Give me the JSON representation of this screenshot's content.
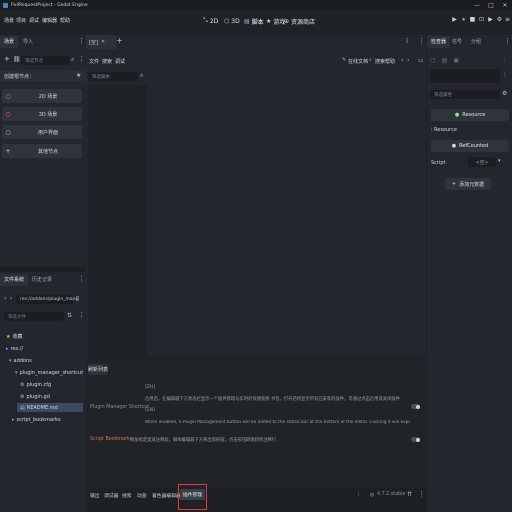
{
  "window": {
    "title": "PullRequestProject - Godot Engine",
    "minimize": "—",
    "maximize": "□",
    "close": "✕"
  },
  "menus": [
    "场景",
    "项目",
    "调试",
    "编辑器",
    "帮助"
  ],
  "workspaces": [
    {
      "icon": "⤡",
      "label": "2D"
    },
    {
      "icon": "⬡",
      "label": "3D"
    },
    {
      "icon": "▤",
      "label": "脚本"
    },
    {
      "icon": "★",
      "label": "游戏"
    },
    {
      "icon": "⊕",
      "label": "资源商店"
    }
  ],
  "run_controls": [
    "▶",
    "⏸",
    "■",
    "⊡",
    "▶",
    "⚙",
    "≡"
  ],
  "scene_dock": {
    "tabs": [
      "场景",
      "导入"
    ],
    "filter_placeholder": "筛选节点",
    "create_root_label": "创建根节点：",
    "root_buttons": [
      {
        "icon": "○",
        "color": "#8da5f3",
        "label": "2D 场景"
      },
      {
        "icon": "○",
        "color": "#fc7f7f",
        "label": "3D 场景"
      },
      {
        "icon": "○",
        "color": "#8eef97",
        "label": "用户界面"
      },
      {
        "icon": "+",
        "color": "#d6d8dc",
        "label": "其他节点"
      }
    ]
  },
  "filesystem_dock": {
    "tabs": [
      "文件系统",
      "历史记录"
    ],
    "path": "res://addons/plugin_mana",
    "filter_placeholder": "筛选文件",
    "tree": [
      {
        "label": "收藏",
        "icon": "★",
        "indent": 0,
        "selected": false
      },
      {
        "label": "res://",
        "icon": "▸",
        "indent": 0,
        "selected": false
      },
      {
        "label": "addons",
        "icon": "▾",
        "indent": 1,
        "selected": false
      },
      {
        "label": "plugin_manager_shortcut",
        "icon": "▾",
        "indent": 2,
        "selected": false
      },
      {
        "label": "plugin.cfg",
        "icon": "⚙",
        "indent": 3,
        "selected": false
      },
      {
        "label": "plugin.gd",
        "icon": "⚙",
        "indent": 3,
        "selected": false
      },
      {
        "label": "README.md",
        "icon": "▤",
        "indent": 3,
        "selected": true
      },
      {
        "label": "script_bookmarks",
        "icon": "▸",
        "indent": 2,
        "selected": false
      }
    ]
  },
  "script_editor": {
    "tab_label": "[空]",
    "menus": [
      "文件",
      "搜索",
      "调试"
    ],
    "online_docs": "在线文档",
    "search_help": "搜索帮助",
    "filter_placeholder": "筛选脚本"
  },
  "plugin_panel": {
    "refresh_button": "刷新列表",
    "plugins": [
      {
        "name": "Plugin Manager Shortcut",
        "name_color": "#8a8f97",
        "lines": [
          "[ZH]",
          "启用后，在编辑器下方状态栏显示一个插件管理与实时的快捷面板 书签，打开后将显示所有已安装的插件，可通过点击启用或关闭插件",
          "[EN]",
          "When enabled, a Plugin Management button will be added to the status bar at the bottom of the editor. Clicking it will expand a panel"
        ]
      },
      {
        "name": "Script Bookmarks",
        "name_color": "#d96b6b",
        "lines": [
          "添加指定类或注释段，脚本编辑器下方将出现按钮，点击按钮即跳转到注释行"
        ]
      }
    ]
  },
  "bottom_bar": {
    "tabs": [
      "输出",
      "调试器",
      "搜索",
      "动画",
      "着色器编辑器",
      "插件管理"
    ],
    "active_tab": "插件管理",
    "version": "4.7.2.stable"
  },
  "inspector": {
    "tabs": [
      "检查器",
      "信号",
      "分组"
    ],
    "filter_placeholder": "筛选属性",
    "resource_button": "Resource",
    "section_label": "Resource",
    "refcounted_button": "RefCounted",
    "script_label": "Script",
    "script_value": "<空>",
    "add_metadata": "添加元数据"
  },
  "colors": {
    "accent": "#478cbf",
    "highlight_red": "#e23b3b"
  }
}
